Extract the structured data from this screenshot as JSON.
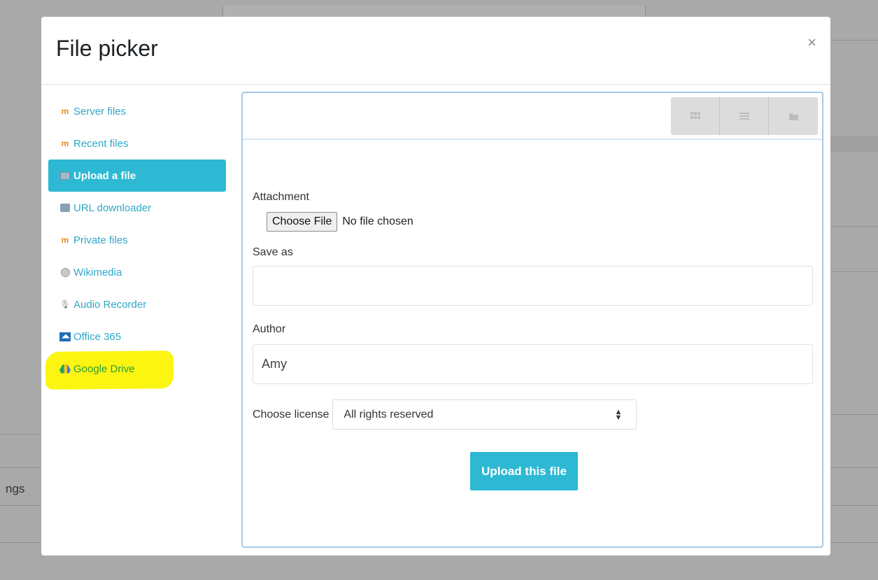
{
  "backdrop": {
    "partial_text": "ngs"
  },
  "modal": {
    "title": "File picker",
    "close_glyph": "×"
  },
  "repositories": [
    {
      "label": "Server files",
      "icon": "moodle-icon",
      "active": false
    },
    {
      "label": "Recent files",
      "icon": "moodle-icon",
      "active": false
    },
    {
      "label": "Upload a file",
      "icon": "upload-icon",
      "active": true
    },
    {
      "label": "URL downloader",
      "icon": "url-downloader-icon",
      "active": false
    },
    {
      "label": "Private files",
      "icon": "moodle-icon",
      "active": false
    },
    {
      "label": "Wikimedia",
      "icon": "wikimedia-icon",
      "active": false
    },
    {
      "label": "Audio Recorder",
      "icon": "microphone-icon",
      "active": false
    },
    {
      "label": "Office 365",
      "icon": "office365-icon",
      "active": false
    },
    {
      "label": "Google Drive",
      "icon": "google-drive-icon",
      "active": false,
      "highlighted": true
    }
  ],
  "toolbar": {
    "view_buttons": [
      "icons-view-icon",
      "list-view-icon",
      "tree-view-icon"
    ]
  },
  "form": {
    "attachment_label": "Attachment",
    "choose_file_label": "Choose File",
    "no_file_text": "No file chosen",
    "save_as_label": "Save as",
    "save_as_value": "",
    "author_label": "Author",
    "author_value": "Amy",
    "license_label": "Choose license",
    "license_value": "All rights reserved",
    "upload_label": "Upload this file"
  },
  "colors": {
    "accent": "#2db9d4",
    "link": "#2fa8c8",
    "highlight": "#fbf511"
  }
}
